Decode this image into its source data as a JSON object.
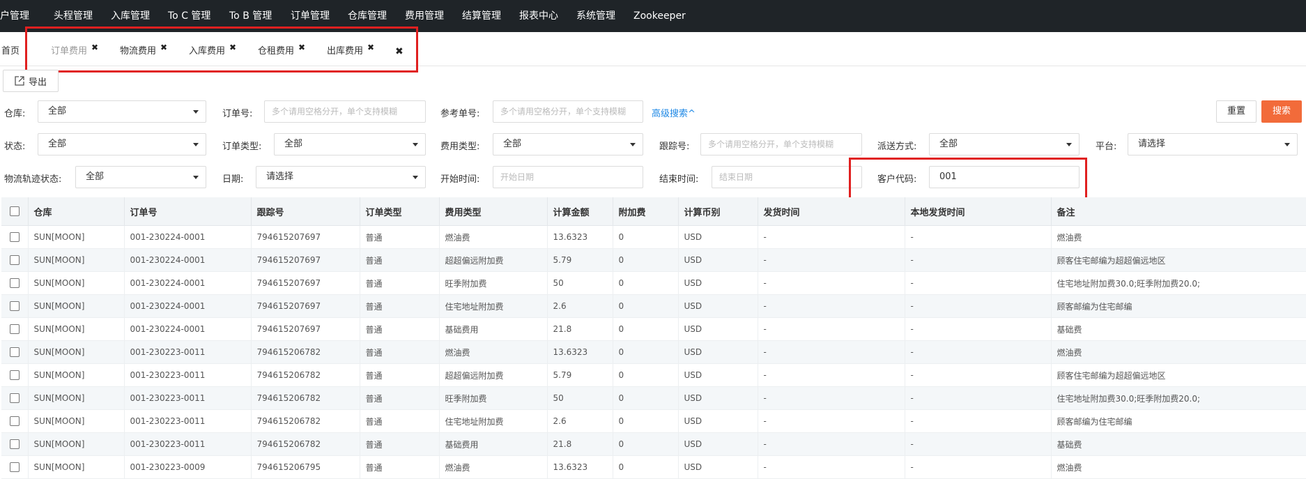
{
  "nav": [
    "客户管理",
    "头程管理",
    "入库管理",
    "To C 管理",
    "To B 管理",
    "订单管理",
    "仓库管理",
    "费用管理",
    "结算管理",
    "报表中心",
    "系统管理",
    "Zookeeper"
  ],
  "tabs": {
    "home": "首页",
    "items": [
      "订单费用",
      "物流费用",
      "入库费用",
      "仓租费用",
      "出库费用"
    ],
    "close_glyph": "✖"
  },
  "toolbar": {
    "export_label": "导出"
  },
  "filters": {
    "warehouse": {
      "label": "仓库:",
      "value": "全部"
    },
    "order_no": {
      "label": "订单号:",
      "placeholder": "多个请用空格分开，单个支持模糊"
    },
    "ref_no": {
      "label": "参考单号:",
      "placeholder": "多个请用空格分开，单个支持模糊"
    },
    "advanced": "高级搜索^",
    "status": {
      "label": "状态:",
      "value": "全部"
    },
    "order_type": {
      "label": "订单类型:",
      "value": "全部"
    },
    "fee_type": {
      "label": "费用类型:",
      "value": "全部"
    },
    "tracking_no": {
      "label": "跟踪号:",
      "placeholder": "多个请用空格分开，单个支持模糊"
    },
    "delivery": {
      "label": "派送方式:",
      "value": "全部"
    },
    "platform": {
      "label": "平台:",
      "value": "请选择"
    },
    "track_status": {
      "label": "物流轨迹状态:",
      "value": "全部"
    },
    "date": {
      "label": "日期:",
      "value": "请选择"
    },
    "start_time": {
      "label": "开始时间:",
      "placeholder": "开始日期"
    },
    "end_time": {
      "label": "结束时间:",
      "placeholder": "结束日期"
    },
    "customer_code": {
      "label": "客户代码:",
      "value": "001"
    },
    "reset": "重置",
    "search": "搜索"
  },
  "table": {
    "columns": [
      "仓库",
      "订单号",
      "跟踪号",
      "订单类型",
      "费用类型",
      "计算金额",
      "附加费",
      "计算币别",
      "发货时间",
      "本地发货时间",
      "备注"
    ],
    "rows": [
      [
        "SUN[MOON]",
        "001-230224-0001",
        "794615207697",
        "普通",
        "燃油费",
        "13.6323",
        "0",
        "USD",
        "-",
        "-",
        "燃油费"
      ],
      [
        "SUN[MOON]",
        "001-230224-0001",
        "794615207697",
        "普通",
        "超超偏远附加费",
        "5.79",
        "0",
        "USD",
        "-",
        "-",
        "顾客住宅邮编为超超偏远地区"
      ],
      [
        "SUN[MOON]",
        "001-230224-0001",
        "794615207697",
        "普通",
        "旺季附加费",
        "50",
        "0",
        "USD",
        "-",
        "-",
        "住宅地址附加费30.0;旺季附加费20.0;"
      ],
      [
        "SUN[MOON]",
        "001-230224-0001",
        "794615207697",
        "普通",
        "住宅地址附加费",
        "2.6",
        "0",
        "USD",
        "-",
        "-",
        "顾客邮编为住宅邮编"
      ],
      [
        "SUN[MOON]",
        "001-230224-0001",
        "794615207697",
        "普通",
        "基础费用",
        "21.8",
        "0",
        "USD",
        "-",
        "-",
        "基础费"
      ],
      [
        "SUN[MOON]",
        "001-230223-0011",
        "794615206782",
        "普通",
        "燃油费",
        "13.6323",
        "0",
        "USD",
        "-",
        "-",
        "燃油费"
      ],
      [
        "SUN[MOON]",
        "001-230223-0011",
        "794615206782",
        "普通",
        "超超偏远附加费",
        "5.79",
        "0",
        "USD",
        "-",
        "-",
        "顾客住宅邮编为超超偏远地区"
      ],
      [
        "SUN[MOON]",
        "001-230223-0011",
        "794615206782",
        "普通",
        "旺季附加费",
        "50",
        "0",
        "USD",
        "-",
        "-",
        "住宅地址附加费30.0;旺季附加费20.0;"
      ],
      [
        "SUN[MOON]",
        "001-230223-0011",
        "794615206782",
        "普通",
        "住宅地址附加费",
        "2.6",
        "0",
        "USD",
        "-",
        "-",
        "顾客邮编为住宅邮编"
      ],
      [
        "SUN[MOON]",
        "001-230223-0011",
        "794615206782",
        "普通",
        "基础费用",
        "21.8",
        "0",
        "USD",
        "-",
        "-",
        "基础费"
      ],
      [
        "SUN[MOON]",
        "001-230223-0009",
        "794615206795",
        "普通",
        "燃油费",
        "13.6323",
        "0",
        "USD",
        "-",
        "-",
        "燃油费"
      ]
    ]
  },
  "colors": {
    "nav_bg": "#1f2428",
    "accent": "#f26b3a",
    "link": "#1e88e5",
    "highlight": "#e02020"
  }
}
